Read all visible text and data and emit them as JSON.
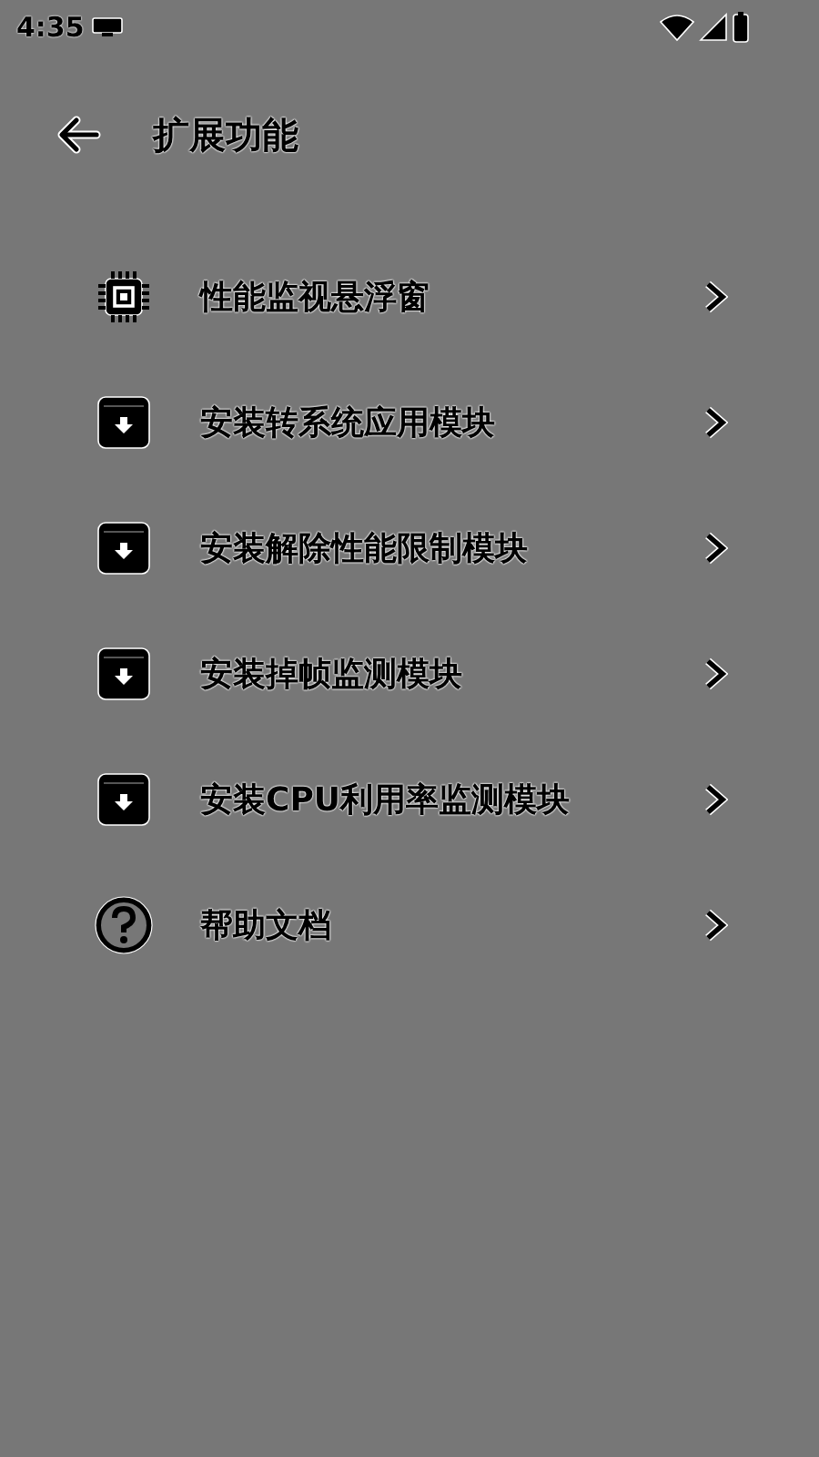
{
  "status_bar": {
    "time": "4:35"
  },
  "app_bar": {
    "title": "扩展功能"
  },
  "items": [
    {
      "kind": "chip",
      "label": "性能监视悬浮窗"
    },
    {
      "kind": "package",
      "label": "安装转系统应用模块"
    },
    {
      "kind": "package",
      "label": "安装解除性能限制模块"
    },
    {
      "kind": "package",
      "label": "安装掉帧监测模块"
    },
    {
      "kind": "package",
      "label": "安装CPU利用率监测模块"
    },
    {
      "kind": "help",
      "label": "帮助文档"
    }
  ]
}
